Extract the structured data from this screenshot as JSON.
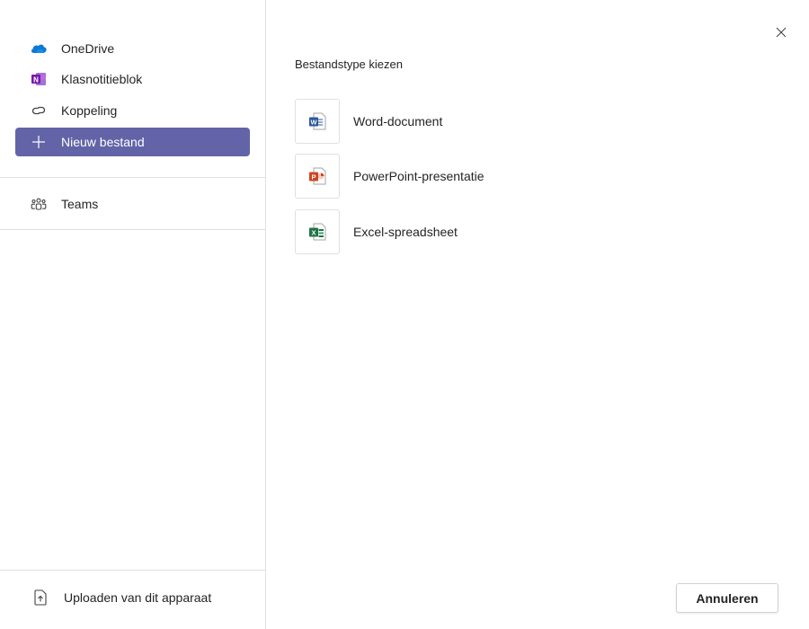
{
  "sidebar": {
    "items": [
      {
        "label": "OneDrive",
        "icon": "onedrive-cloud-icon"
      },
      {
        "label": "Klasnotitieblok",
        "icon": "onenote-icon"
      },
      {
        "label": "Koppeling",
        "icon": "link-icon"
      },
      {
        "label": "Nieuw bestand",
        "icon": "plus-icon",
        "active": true
      }
    ],
    "teams": {
      "label": "Teams",
      "icon": "teams-people-icon"
    },
    "upload": {
      "label": "Uploaden van dit apparaat",
      "icon": "upload-icon"
    }
  },
  "main": {
    "title": "Bestandstype kiezen",
    "options": [
      {
        "label": "Word-document",
        "icon": "word-icon",
        "color": "#2b579a"
      },
      {
        "label": "PowerPoint-presentatie",
        "icon": "powerpoint-icon",
        "color": "#d04423"
      },
      {
        "label": "Excel-spreadsheet",
        "icon": "excel-icon",
        "color": "#217346"
      }
    ],
    "cancel_label": "Annuleren"
  },
  "colors": {
    "accent": "#6264a7",
    "border": "#e1e1e1"
  }
}
